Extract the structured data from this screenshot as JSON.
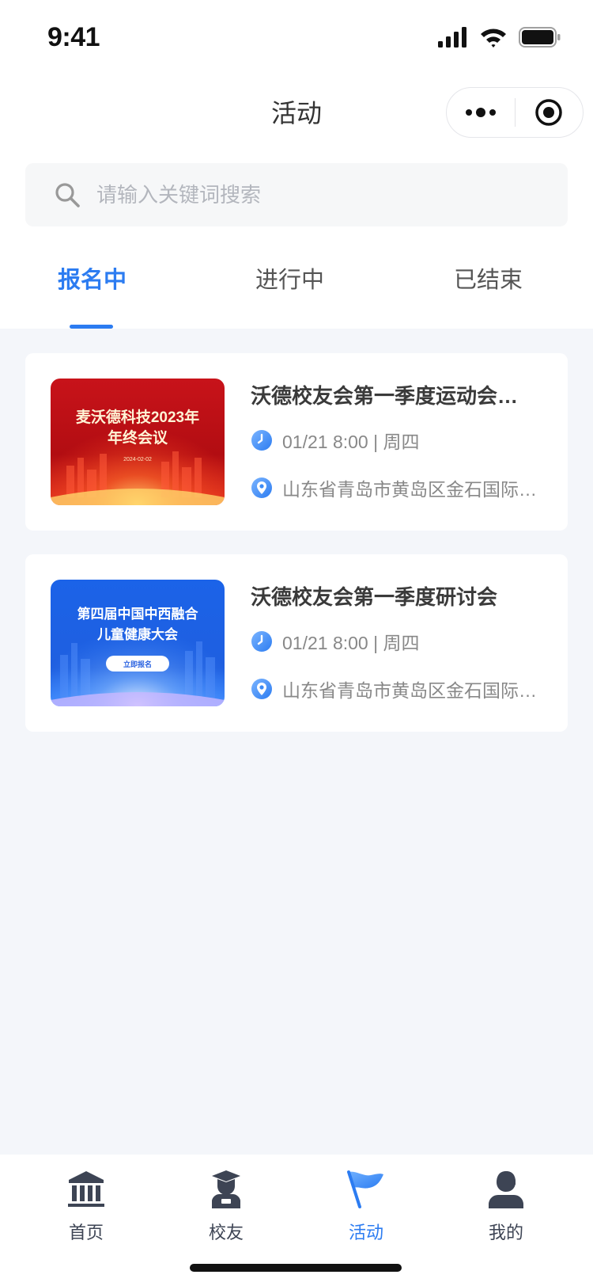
{
  "status_bar": {
    "time": "9:41"
  },
  "nav": {
    "title": "活动",
    "capsule": {
      "more_icon": "more-dots-icon",
      "close_icon": "target-circle-icon"
    }
  },
  "search": {
    "placeholder": "请输入关键词搜索",
    "value": "",
    "icon": "search-icon"
  },
  "tabs": [
    {
      "label": "报名中",
      "active": true
    },
    {
      "label": "进行中",
      "active": false
    },
    {
      "label": "已结束",
      "active": false
    }
  ],
  "events": [
    {
      "title": "沃德校友会第一季度运动会…",
      "time": "01/21 8:00 | 周四",
      "location": "山东省青岛市黄岛区金石国际…",
      "banner": {
        "theme": "red",
        "line1": "麦沃德科技2023年",
        "line2": "年终会议",
        "date": "2024-02-02"
      }
    },
    {
      "title": "沃德校友会第一季度研讨会",
      "time": "01/21 8:00 | 周四",
      "location": "山东省青岛市黄岛区金石国际…",
      "banner": {
        "theme": "blue",
        "line1": "第四届中国中西融合",
        "line2": "儿童健康大会",
        "button": "立即报名"
      }
    }
  ],
  "tabbar": [
    {
      "label": "首页",
      "icon": "home-building-icon",
      "active": false
    },
    {
      "label": "校友",
      "icon": "alumni-graduate-icon",
      "active": false
    },
    {
      "label": "活动",
      "icon": "activity-flag-icon",
      "active": true
    },
    {
      "label": "我的",
      "icon": "profile-person-icon",
      "active": false
    }
  ],
  "colors": {
    "accent": "#2c7cf1",
    "background": "#f4f6fa",
    "card": "#ffffff"
  }
}
